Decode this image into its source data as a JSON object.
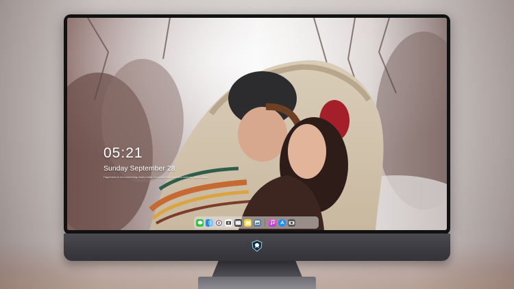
{
  "lock_screen": {
    "time": "05:21",
    "date": "Sunday September  28",
    "quote": "Happiness is not something ready made. It comes from your own actions.  Dalai Lama"
  },
  "dock": {
    "apps": [
      {
        "name": "messages-icon",
        "color": "#2fbf4a"
      },
      {
        "name": "finder-icon",
        "color": "#2a86e0"
      },
      {
        "name": "safari-icon",
        "color": "#e9e9ee"
      },
      {
        "name": "photos-icon",
        "color": "#f1f1f1"
      },
      {
        "name": "clapperboard-icon",
        "color": "#3a3a3a"
      },
      {
        "name": "notes-icon",
        "color": "#f7d23e"
      },
      {
        "name": "preview-icon",
        "color": "#5a7fa8"
      },
      {
        "name": "music-icon",
        "color": "#e545c9"
      },
      {
        "name": "app-store-icon",
        "color": "#1d8cf5"
      },
      {
        "name": "camera-icon",
        "color": "#5a5a5a"
      }
    ]
  },
  "colors": {
    "frame": "#121212",
    "chin": "#3b3b41",
    "text": "#ffffff"
  }
}
